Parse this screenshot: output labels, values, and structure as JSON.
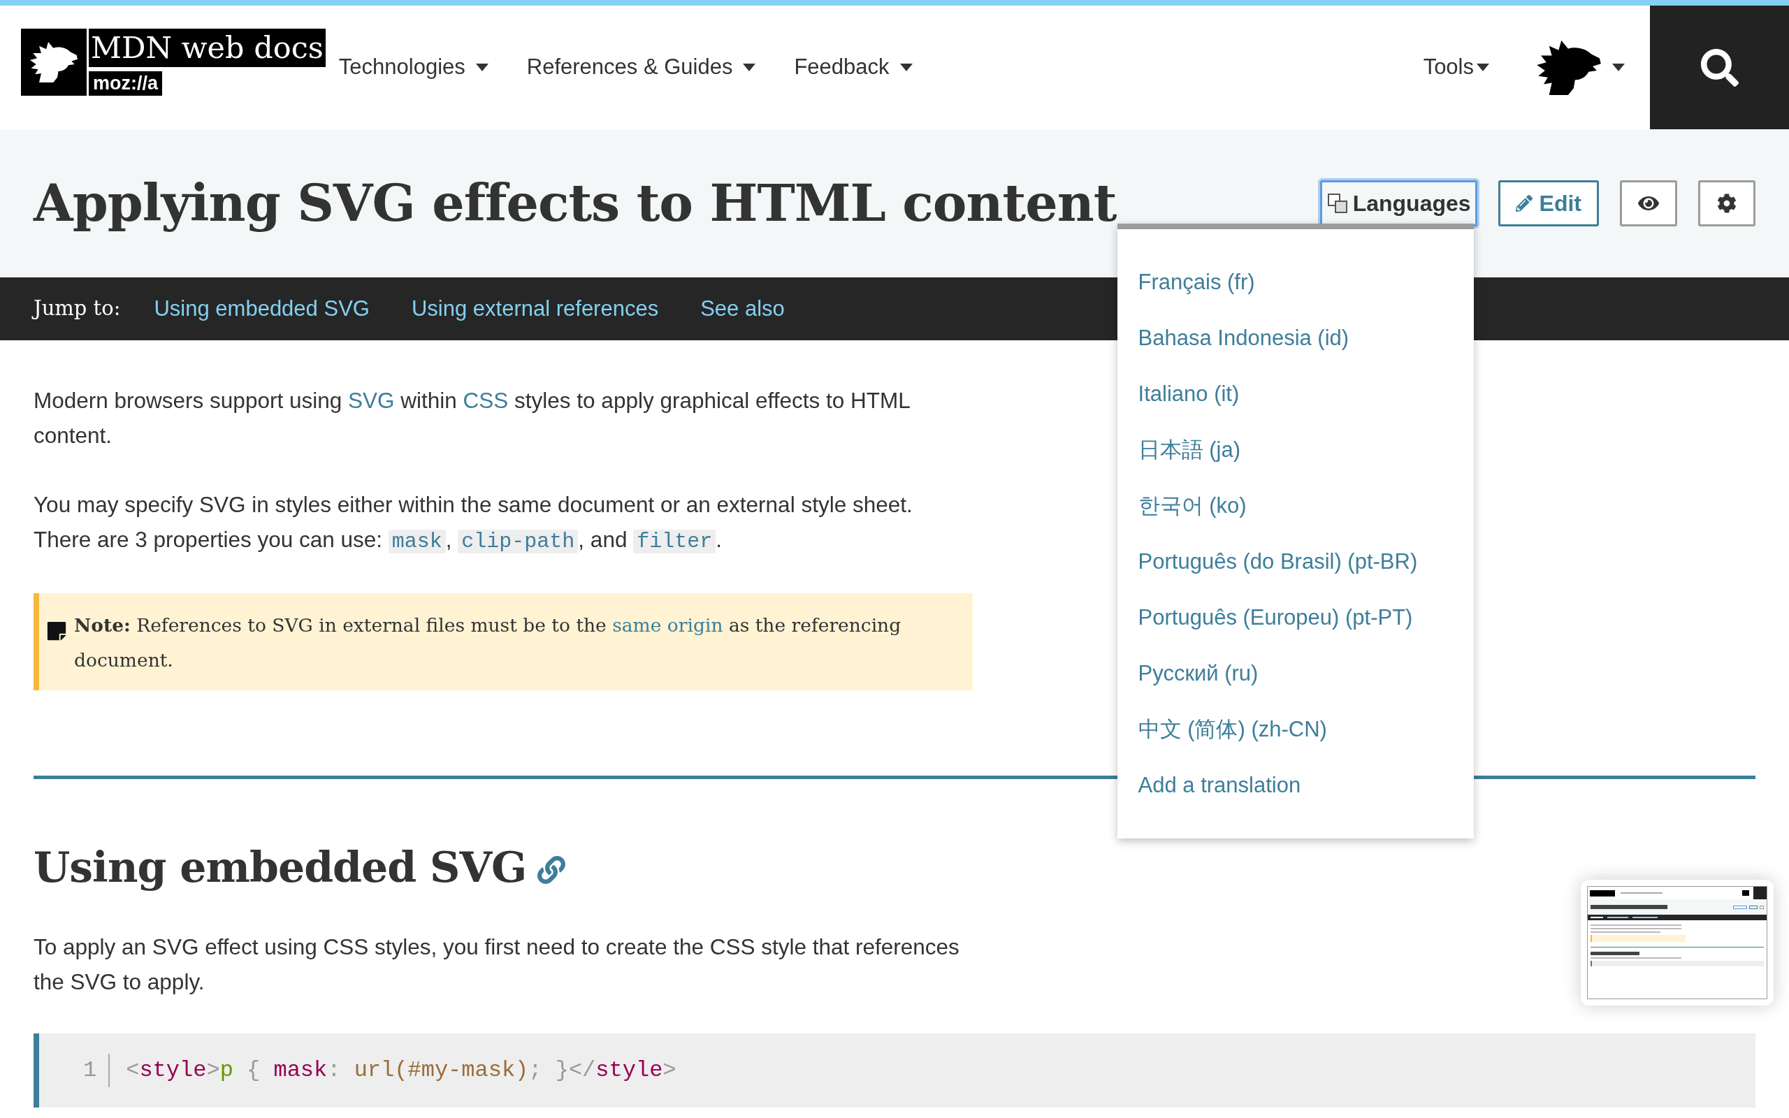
{
  "header": {
    "logo": {
      "wordmark": "MDN web docs",
      "tagline": "moz://a"
    },
    "nav": [
      {
        "label": "Technologies"
      },
      {
        "label": "References & Guides"
      },
      {
        "label": "Feedback"
      }
    ],
    "tools": {
      "label": "Tools"
    }
  },
  "page_header": {
    "title": "Applying SVG effects to HTML content",
    "buttons": [
      {
        "kind": "languages",
        "label": "Languages",
        "expanded": true,
        "menu": [
          "Français (fr)",
          "Bahasa Indonesia (id)",
          "Italiano (it)",
          "日本語 (ja)",
          "한국어 (ko)",
          "Português (do Brasil) (pt-BR)",
          "Português (Europeu) (pt-PT)",
          "Русский (ru)",
          "中文 (简体) (zh-CN)",
          "Add a translation"
        ]
      },
      {
        "kind": "edit",
        "label": "Edit"
      },
      {
        "kind": "watch"
      },
      {
        "kind": "settings"
      }
    ]
  },
  "jump_bar": {
    "label": "Jump to:",
    "links": [
      "Using embedded SVG",
      "Using external references",
      "See also"
    ]
  },
  "content": {
    "blocks": [
      {
        "kind": "paragraph",
        "parts": [
          {
            "kind": "text",
            "text": "Modern browsers support using "
          },
          {
            "kind": "link",
            "text": "SVG"
          },
          {
            "kind": "text",
            "text": " within "
          },
          {
            "kind": "link",
            "text": "CSS"
          },
          {
            "kind": "text",
            "text": " styles to apply graphical effects to HTML content."
          }
        ]
      },
      {
        "kind": "paragraph",
        "parts": [
          {
            "kind": "text",
            "text": "You may specify SVG in styles either within the same document or an external style sheet. There are 3 properties you can use: "
          },
          {
            "kind": "code",
            "text": "mask"
          },
          {
            "kind": "text",
            "text": ", "
          },
          {
            "kind": "code",
            "text": "clip-path"
          },
          {
            "kind": "text",
            "text": ", and "
          },
          {
            "kind": "code",
            "text": "filter"
          },
          {
            "kind": "text",
            "text": "."
          }
        ]
      },
      {
        "kind": "note",
        "parts": [
          {
            "kind": "text",
            "text": "**Note:** References to SVG in external files must be to the "
          },
          {
            "kind": "link",
            "text": "same origin"
          },
          {
            "kind": "text",
            "text": " as the referencing document."
          }
        ]
      },
      {
        "kind": "heading",
        "text": "Using embedded SVG"
      },
      {
        "kind": "paragraph",
        "parts": [
          {
            "kind": "text",
            "text": "To apply an SVG effect using CSS styles, you first need to create the CSS style that references the SVG to apply."
          }
        ]
      },
      {
        "kind": "code_block",
        "lines": [
          {
            "number": "1",
            "tokens": [
              {
                "kind": "punctuation",
                "text": "<"
              },
              {
                "kind": "tag",
                "text": "style"
              },
              {
                "kind": "punctuation",
                "text": ">"
              },
              {
                "kind": "selector",
                "text": "p"
              },
              {
                "kind": "punctuation",
                "text": " { "
              },
              {
                "kind": "property",
                "text": "mask"
              },
              {
                "kind": "punctuation",
                "text": ": "
              },
              {
                "kind": "value",
                "text": "url(#my-mask)"
              },
              {
                "kind": "punctuation",
                "text": "; }</"
              },
              {
                "kind": "tag",
                "text": "style"
              },
              {
                "kind": "punctuation",
                "text": ">"
              }
            ]
          }
        ]
      }
    ]
  }
}
